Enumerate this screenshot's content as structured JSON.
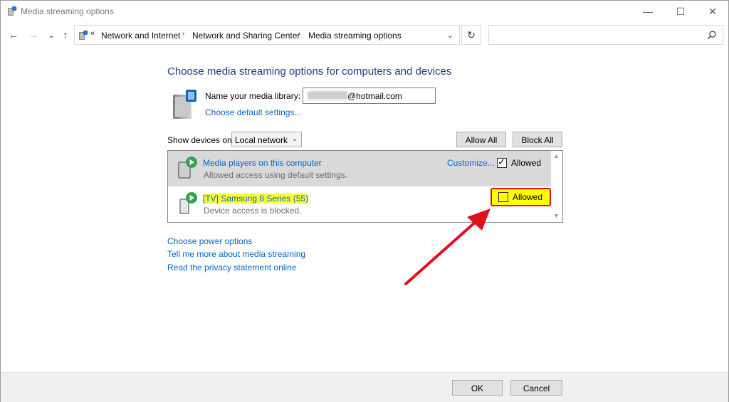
{
  "window": {
    "title": "Media streaming options"
  },
  "controls": {
    "minimize": "—",
    "maximize": "☐",
    "close": "✕"
  },
  "nav": {
    "back": "←",
    "forward": "→",
    "recent": "⌄",
    "up": "↑",
    "overflow": "«",
    "refresh": "↻",
    "breadcrumbs": [
      "Network and Internet",
      "Network and Sharing Center",
      "Media streaming options"
    ],
    "search_placeholder": ""
  },
  "content": {
    "heading": "Choose media streaming options for computers and devices",
    "library_label": "Name your media library:",
    "library_value": "@hotmail.com",
    "default_settings_link": "Choose default settings...",
    "show_devices_label": "Show devices on:",
    "show_devices_value": "Local network",
    "allow_all": "Allow All",
    "block_all": "Block All"
  },
  "devices": [
    {
      "name": "Media players on this computer",
      "status": "Allowed access using default settings.",
      "customize": "Customize...",
      "allowed_label": "Allowed",
      "allowed": true
    },
    {
      "name": "[TV] Samsung 8 Series (55)",
      "status": "Device access is blocked.",
      "allowed_label": "Allowed",
      "allowed": false
    }
  ],
  "links": {
    "power": "Choose power options",
    "tell_more": "Tell me more about media streaming",
    "privacy": "Read the privacy statement online"
  },
  "footer": {
    "ok": "OK",
    "cancel": "Cancel"
  },
  "colors": {
    "heading": "#1e3d8f",
    "link": "#0066cc",
    "highlight": "#ffff00",
    "annotation": "#e2101a"
  }
}
